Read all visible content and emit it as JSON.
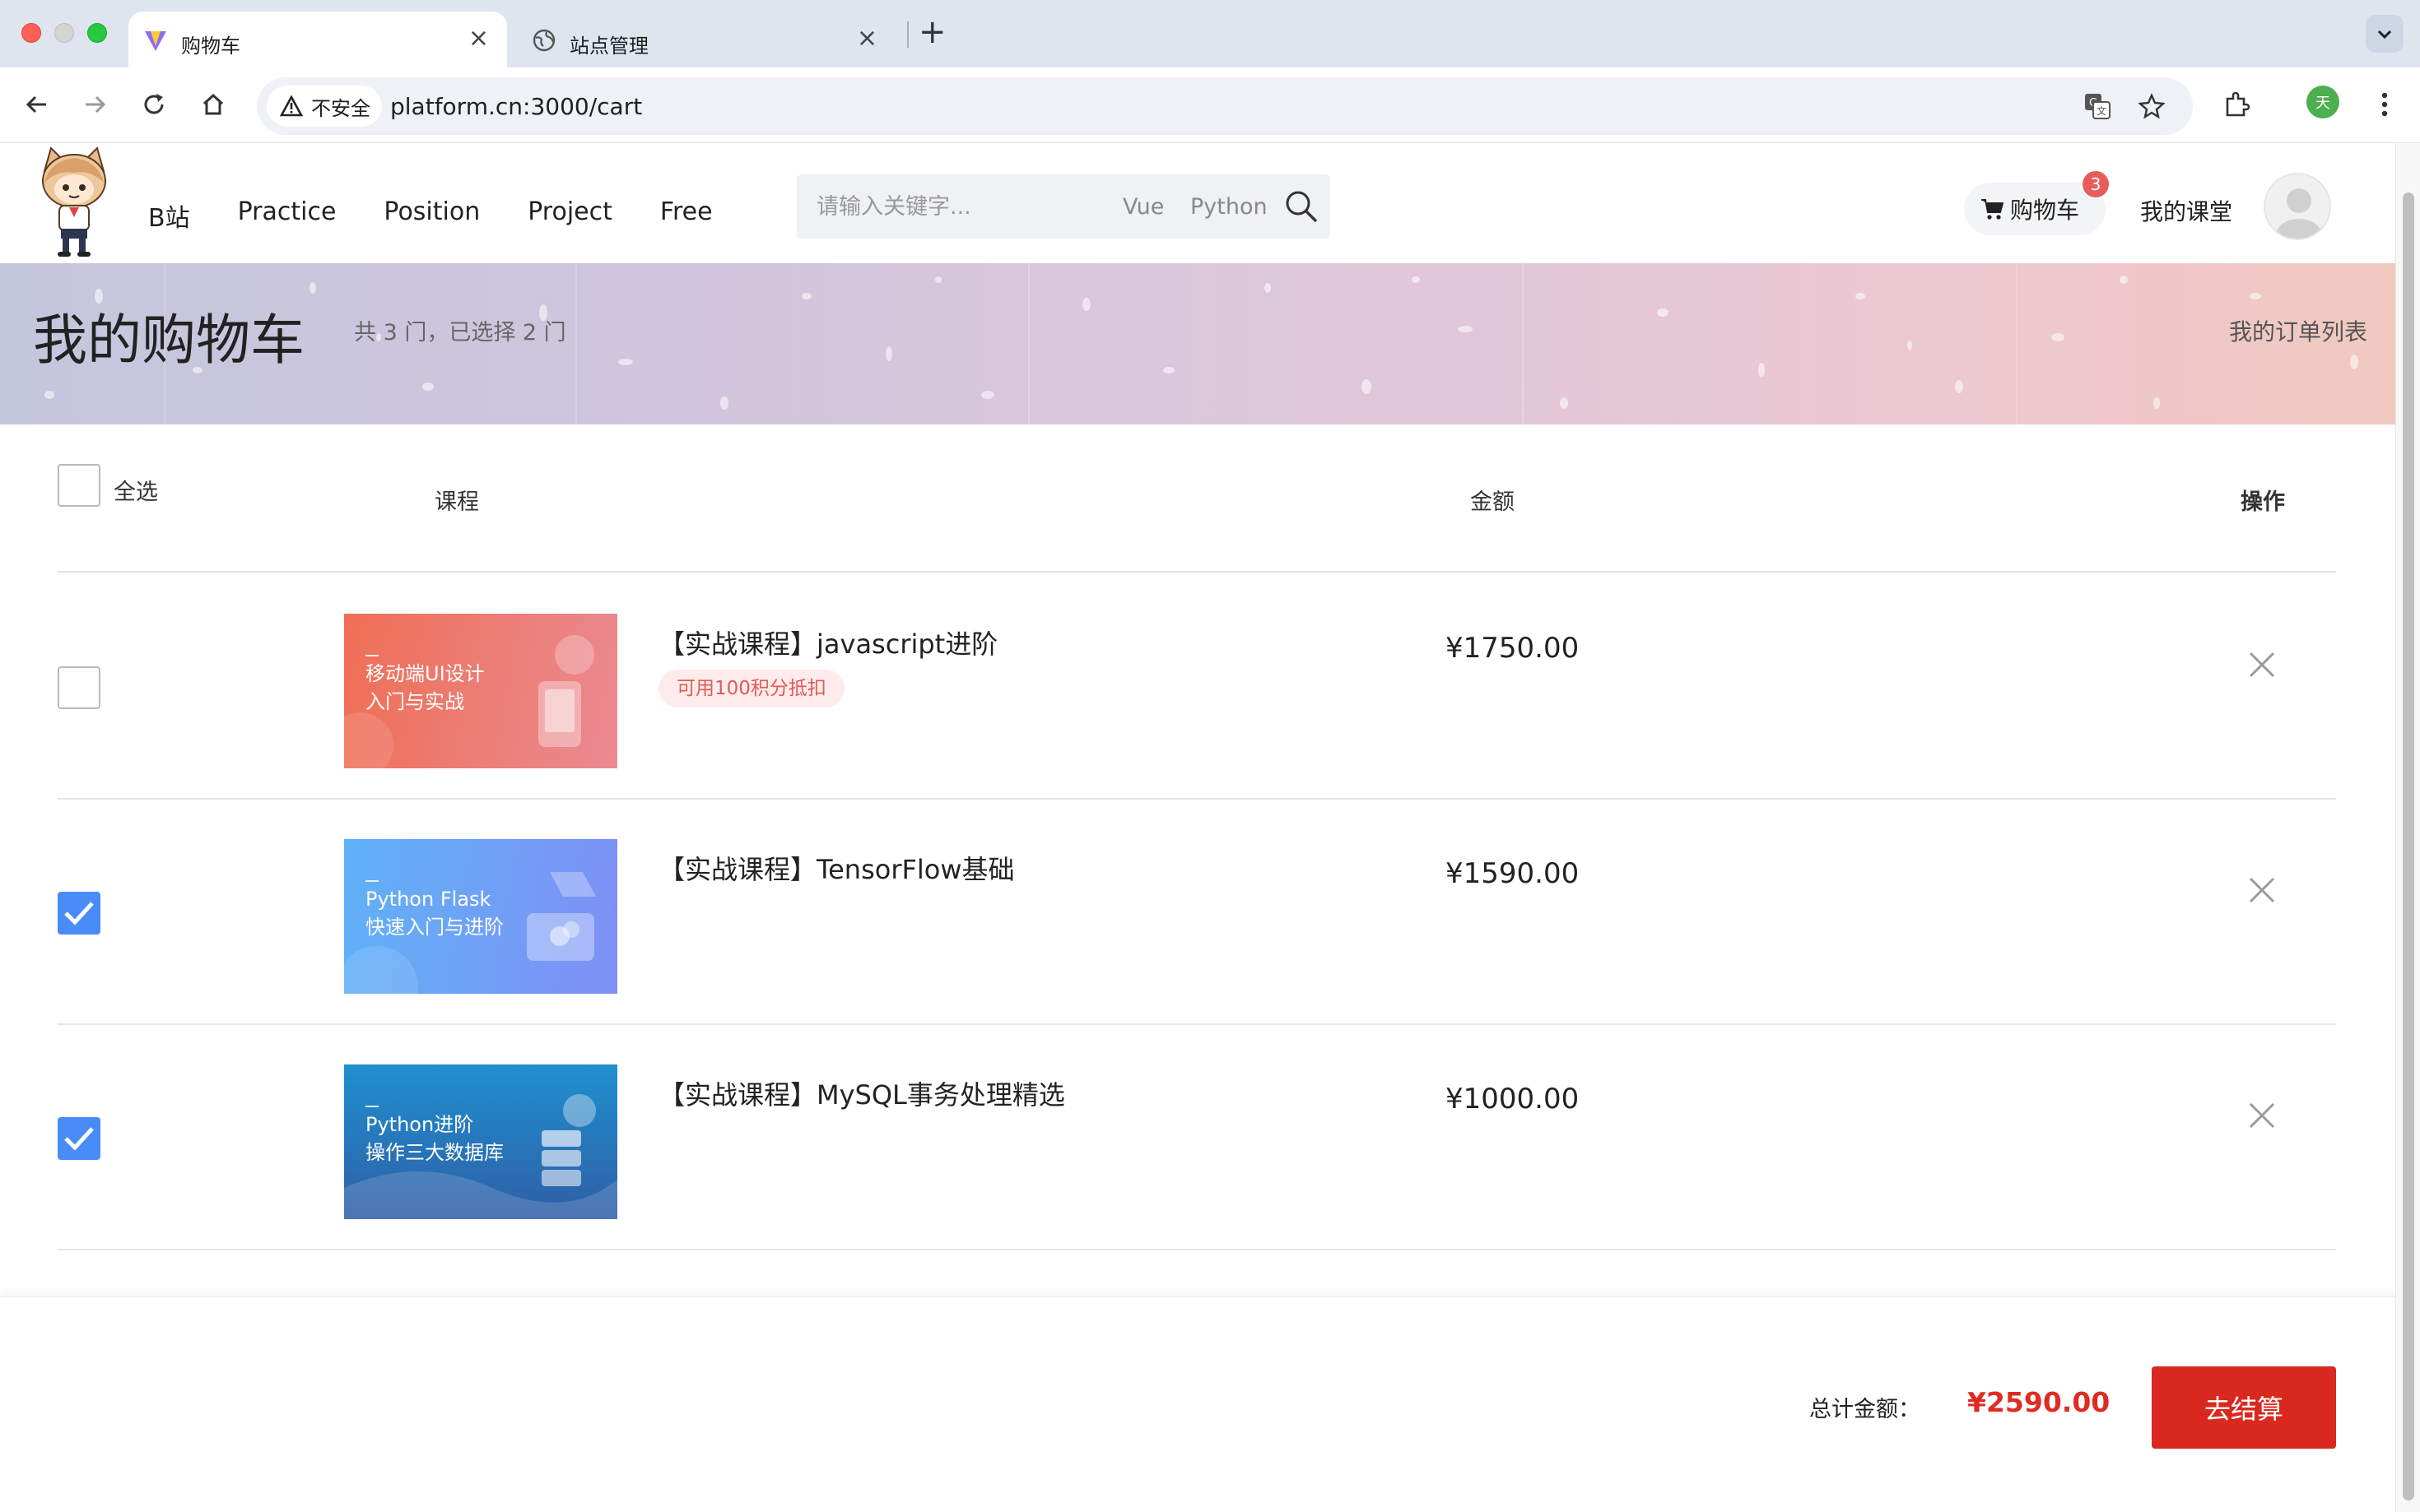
{
  "browser": {
    "tabs": [
      {
        "title": "购物车",
        "favicon": "vite-icon",
        "active": true
      },
      {
        "title": "站点管理",
        "favicon": "globe-icon",
        "active": false
      }
    ],
    "security_label": "不安全",
    "url": "platform.cn:3000/cart",
    "profile_initial": "天"
  },
  "header": {
    "nav": [
      "B站",
      "Practice",
      "Position",
      "Project",
      "Free"
    ],
    "search": {
      "placeholder": "请输入关键字...",
      "tags": [
        "Vue",
        "Python"
      ]
    },
    "cart_label": "购物车",
    "cart_count": "3",
    "my_class": "我的课堂"
  },
  "banner": {
    "title": "我的购物车",
    "summary": "共 3 门，已选择 2 门",
    "orders_link": "我的订单列表"
  },
  "table": {
    "select_all": "全选",
    "columns": {
      "course": "课程",
      "amount": "金额",
      "action": "操作"
    },
    "rows": [
      {
        "checked": false,
        "image_lines": "移动端UI设计\n入门与实战",
        "title": "【实战课程】javascript进阶",
        "tag": "可用100积分抵扣",
        "price": "¥1750.00",
        "image_colors": [
          "#ef6f55",
          "#ea8a92"
        ]
      },
      {
        "checked": true,
        "image_lines": "Python Flask\n快速入门与进阶",
        "title": "【实战课程】TensorFlow基础",
        "tag": "",
        "price": "¥1590.00",
        "image_colors": [
          "#5fb2f7",
          "#7f8ff5"
        ]
      },
      {
        "checked": true,
        "image_lines": "Python进阶\n操作三大数据库",
        "title": "【实战课程】MySQL事务处理精选",
        "tag": "",
        "price": "¥1000.00",
        "image_colors": [
          "#1f90cf",
          "#2f5ea6"
        ]
      }
    ]
  },
  "footer": {
    "total_label": "总计金额：",
    "total_value": "¥2590.00",
    "checkout_label": "去结算"
  },
  "colors": {
    "accent": "#d9291f",
    "checkbox": "#4a8cf7",
    "badge": "#e85c5c"
  }
}
